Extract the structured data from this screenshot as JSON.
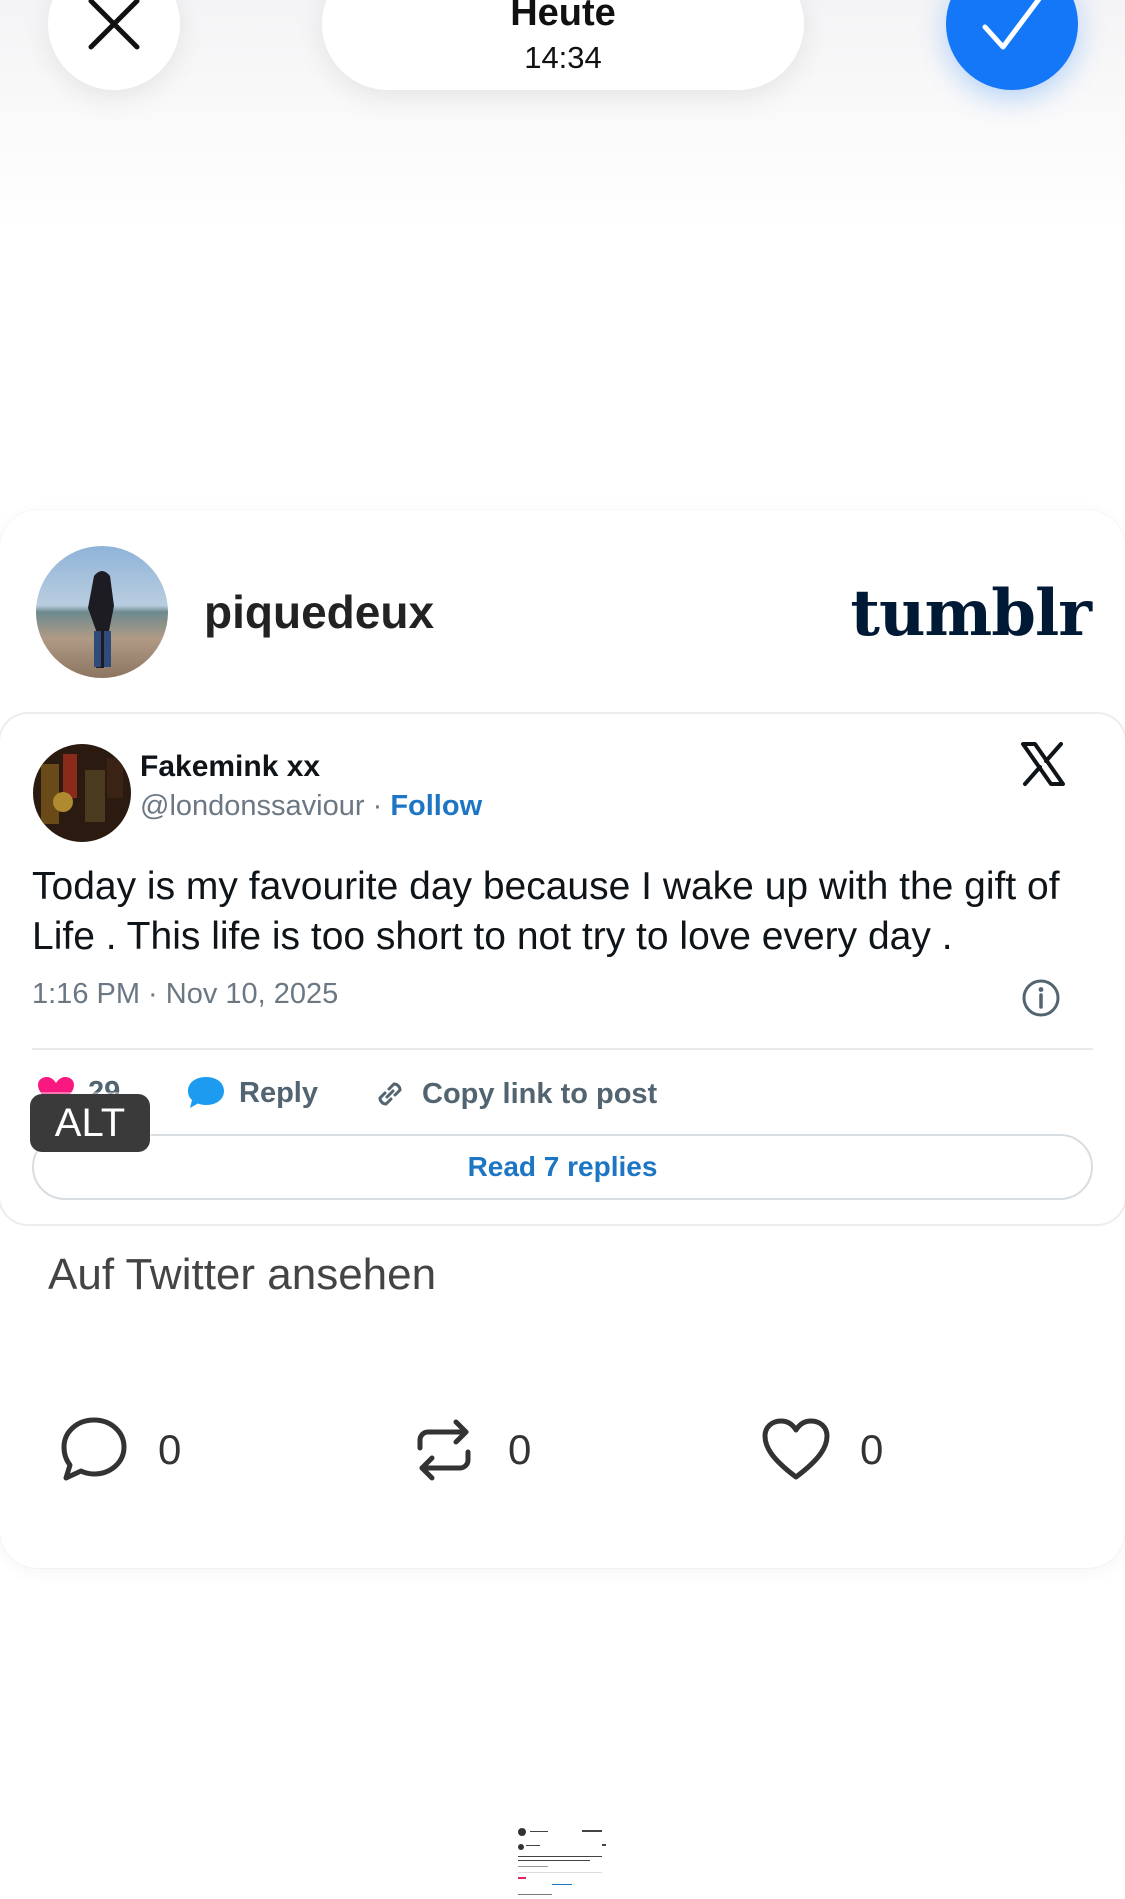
{
  "top_bar": {
    "day": "Heute",
    "time": "14:34"
  },
  "post": {
    "username": "piquedeux",
    "brand": "tumblr",
    "tweet": {
      "display_name": "Fakemink xx",
      "handle": "@londonssaviour",
      "separator": "·",
      "follow_label": "Follow",
      "text": "Today is my favourite day because I wake up with the gift of Life . This life is too short to not try to love every day .",
      "timestamp": "1:16 PM · Nov 10, 2025",
      "like_count": "29",
      "reply_label": "Reply",
      "copy_link_label": "Copy link to post",
      "read_replies_label": "Read 7 replies",
      "alt_badge": "ALT"
    },
    "view_on_twitter": "Auf Twitter ansehen",
    "stats": {
      "comments": "0",
      "reblogs": "0",
      "likes": "0"
    }
  },
  "colors": {
    "accent_blue": "#1477f8",
    "link_blue": "#1d76c4",
    "tumblr_navy": "#001935",
    "like_pink": "#f91880"
  }
}
